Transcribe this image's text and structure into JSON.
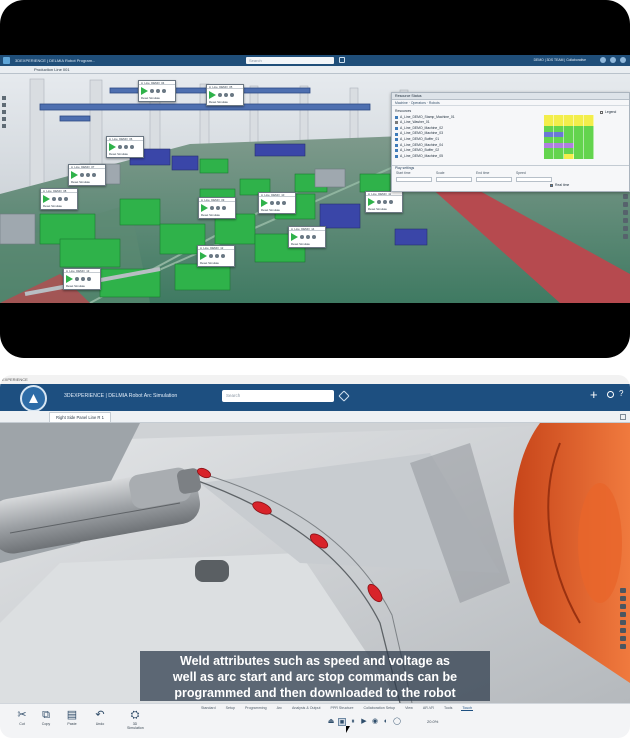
{
  "panel1": {
    "app_brand": "3DEXPERIENCE | DELMIA Robot Program...",
    "search_placeholder": "Search",
    "user_label": "DEMO | 3DS TEAM | Collaborative",
    "tab_label": "Production Line 001",
    "monitor_panel": {
      "title": "Resource Status",
      "subtitle": "Machine  ·  Operators  ·  Robots",
      "tree_header": "Resources",
      "tree_rows": [
        "A_Line_DEMO_Stamp_Machine_01",
        "A_Line_Washer_01",
        "A_Line_DEMO_Machine_02",
        "A_Line_DEMO_Machine_03",
        "A_Line_DEMO_Buffer_01",
        "A_Line_DEMO_Machine_04",
        "A_Line_DEMO_Buffer_02",
        "A_Line_DEMO_Machine_05"
      ],
      "tree_colors": [
        "#3e7bb9",
        "#7a7a7a",
        "#3e7bb9",
        "#3e7bb9",
        "#3e7bb9",
        "#3e7bb9",
        "#3e7bb9",
        "#3e7bb9"
      ],
      "legend_label": "Legend",
      "settings_header": "Play settings",
      "settings_cols": [
        "Start time",
        "Scale",
        "End time",
        "Speed"
      ],
      "realtime_label": "Real time"
    },
    "monitor_cards": [
      {
        "title": "A_Line_DEMO_04",
        "footer": "Reset Simulate"
      },
      {
        "title": "A_Line_DEMO_05",
        "footer": "Reset Simulate"
      },
      {
        "title": "A_Line_DEMO_06",
        "footer": "Reset Simulate"
      },
      {
        "title": "A_Line_DEMO_07",
        "footer": "Reset Simulate"
      },
      {
        "title": "A_Line_DEMO_08",
        "footer": "Reset Simulate"
      },
      {
        "title": "A_Line_DEMO_09",
        "footer": "Reset Simulate"
      },
      {
        "title": "A_Line_DEMO_10",
        "footer": "Reset Simulate"
      },
      {
        "title": "A_Line_DEMO_11",
        "footer": "Reset Simulate"
      },
      {
        "title": "A_Line_DEMO_12",
        "footer": "Reset Simulate"
      },
      {
        "title": "A_Line_DEMO_13",
        "footer": "Reset Simulate"
      },
      {
        "title": "A_Line_DEMO_14",
        "footer": "Reset Simulate"
      }
    ]
  },
  "panel2": {
    "window_strip": "EXPERIENCE",
    "app_brand": "3DEXPERIENCE | DELMIA Robot Arc Simulation",
    "search_placeholder": "Search",
    "tab_label": "Right Side Panel Line R 1",
    "caption_lines": [
      "Weld attributes such as speed and voltage as",
      "well as arc start and arc stop commands can be",
      "programmed and then downloaded to the robot"
    ],
    "toolbar": [
      {
        "icon": "cut-icon",
        "glyph": "✂",
        "label": "Cut"
      },
      {
        "icon": "copy-icon",
        "glyph": "⧉",
        "label": "Copy"
      },
      {
        "icon": "paste-icon",
        "glyph": "▤",
        "label": "Paste"
      },
      {
        "icon": "undo-icon",
        "glyph": "↶",
        "label": "Undo"
      },
      {
        "icon": "simulation-icon",
        "glyph": "⛭",
        "label": "3D Simulation"
      }
    ],
    "action_tabs": [
      "Standard",
      "Setup",
      "Programming",
      "Arc",
      "Analysis & Output",
      "PPR Structure",
      "Collaboration Setup",
      "View",
      "AR-VR",
      "Tools",
      "Touch"
    ],
    "active_action_tab": "Touch",
    "player_glyphs": [
      "⏏",
      "■",
      "⏸",
      "▶",
      "◉",
      "◐",
      "◯"
    ],
    "zoom_text": "20.0%"
  },
  "colors": {
    "topbar": "#1d4f80",
    "monitor_green": "#2fb24a",
    "weld_bead": "#d8232a",
    "robot_orange": "#e0561f"
  }
}
